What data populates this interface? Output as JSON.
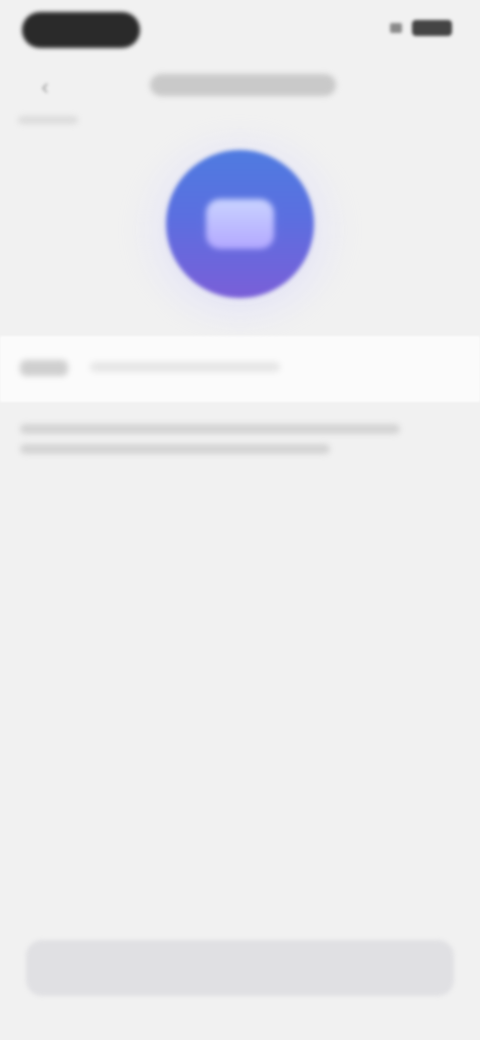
{
  "status_bar": {
    "time": "",
    "icons": [
      "signal-icon",
      "battery-icon"
    ]
  },
  "header": {
    "back_icon": "chevron-left-icon",
    "title": ""
  },
  "hero": {
    "icon": "app-icon",
    "colors": {
      "top": "#4f7be0",
      "bottom": "#7a5fd8"
    }
  },
  "info": {
    "label": "",
    "value": ""
  },
  "description": {
    "text": ""
  },
  "action_button": {
    "label": ""
  }
}
